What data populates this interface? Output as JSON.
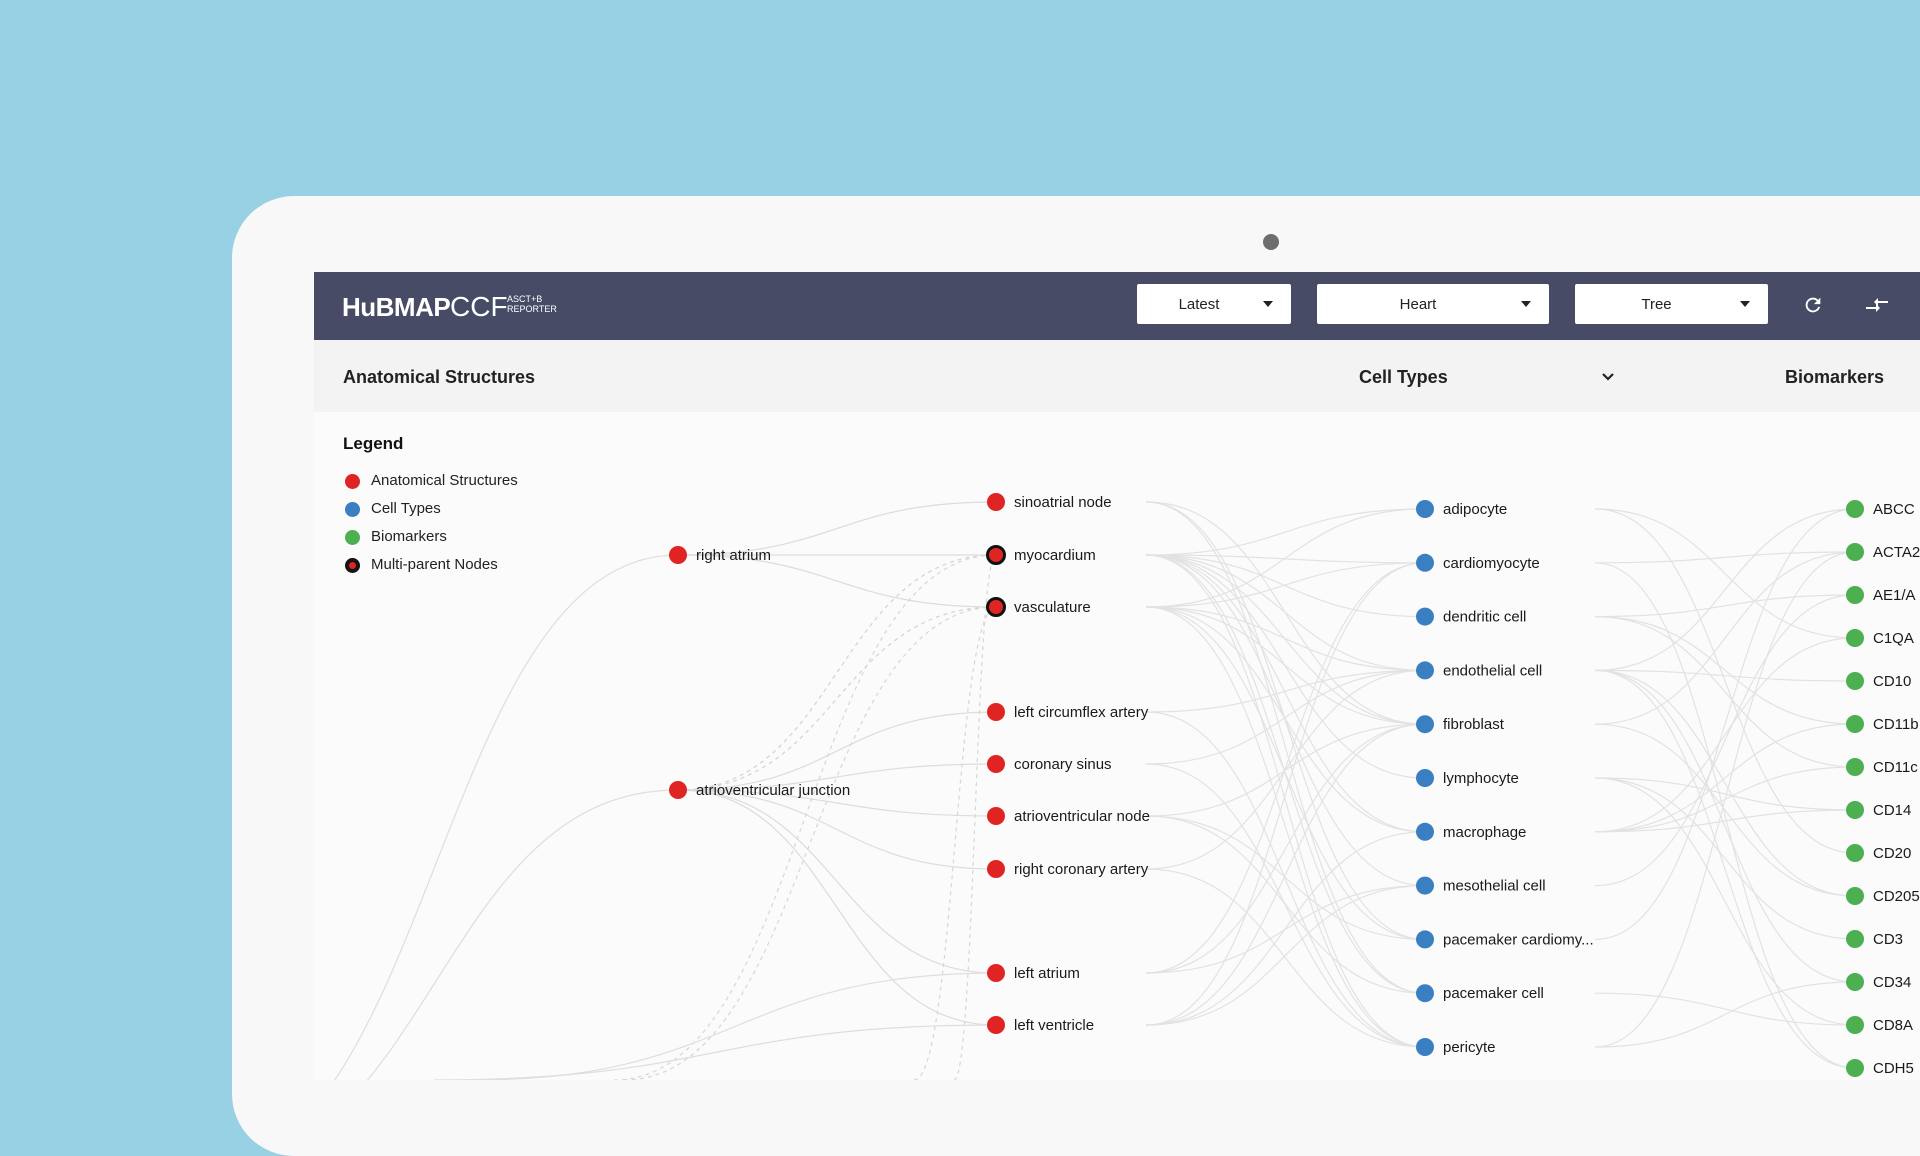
{
  "app": {
    "logo_main": "HuBMAP",
    "logo_ccf": "CCF",
    "logo_sub_line1": "ASCT+B",
    "logo_sub_line2": "REPORTER"
  },
  "toolbar": {
    "version_select": "Latest",
    "organ_select": "Heart",
    "view_select": "Tree",
    "refresh_icon": "refresh-icon",
    "compare_icon": "compare-arrows-icon"
  },
  "columns": {
    "anatomical": "Anatomical Structures",
    "cell_types": "Cell Types",
    "biomarkers": "Biomarkers"
  },
  "legend": {
    "title": "Legend",
    "items": [
      {
        "label": "Anatomical Structures",
        "color": "#e02424",
        "border": "none"
      },
      {
        "label": "Cell Types",
        "color": "#3a7fc1",
        "border": "none"
      },
      {
        "label": "Biomarkers",
        "color": "#4caf50",
        "border": "none"
      },
      {
        "label": "Multi-parent Nodes",
        "color": "#e02424",
        "border": "#111111"
      }
    ]
  },
  "colors": {
    "anatomical": "#e02424",
    "cell_type": "#3a7fc1",
    "biomarker": "#4caf50",
    "navbar": "#474b66"
  },
  "tree": {
    "level1": [
      "right atrium",
      "atrioventricular junction"
    ],
    "level2": [
      {
        "label": "sinoatrial node",
        "multi": false
      },
      {
        "label": "myocardium",
        "multi": true
      },
      {
        "label": "vasculature",
        "multi": true
      },
      {
        "label": "left circumflex artery",
        "multi": false
      },
      {
        "label": "coronary sinus",
        "multi": false
      },
      {
        "label": "atrioventricular node",
        "multi": false
      },
      {
        "label": "right coronary artery",
        "multi": false
      },
      {
        "label": "left atrium",
        "multi": false
      },
      {
        "label": "left ventricle",
        "multi": false
      }
    ],
    "cell_types": [
      "adipocyte",
      "cardiomyocyte",
      "dendritic cell",
      "endothelial cell",
      "fibroblast",
      "lymphocyte",
      "macrophage",
      "mesothelial cell",
      "pacemaker cardiomy...",
      "pacemaker cell",
      "pericyte"
    ],
    "biomarkers": [
      "ABCC",
      "ACTA2",
      "AE1/A",
      "C1QA",
      "CD10",
      "CD11b",
      "CD11c",
      "CD14",
      "CD20",
      "CD205",
      "CD3",
      "CD34",
      "CD8A",
      "CDH5"
    ]
  }
}
